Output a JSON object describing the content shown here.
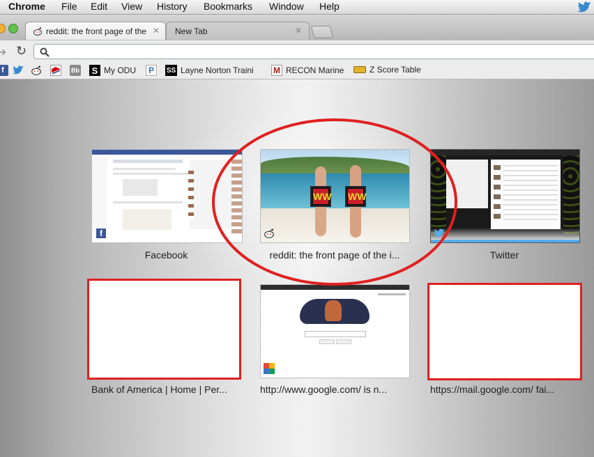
{
  "menubar": {
    "app": "Chrome",
    "items": [
      "File",
      "Edit",
      "View",
      "History",
      "Bookmarks",
      "Window",
      "Help"
    ]
  },
  "tabs": [
    {
      "label": "reddit: the front page of the"
    },
    {
      "label": "New Tab"
    }
  ],
  "toolbar": {
    "omnibox_value": ""
  },
  "bookmarks": [
    {
      "label": "My ODU",
      "icon": "s-icon"
    },
    {
      "label": "P",
      "icon": "p-icon"
    },
    {
      "label": "Layne Norton Traini",
      "icon": "ss-icon"
    },
    {
      "label": "RECON Marine",
      "icon": "m-icon"
    },
    {
      "label": "Z Score Table",
      "icon": "z-score-icon"
    }
  ],
  "tiles": [
    {
      "title": "Facebook"
    },
    {
      "title": "reddit: the front page of the i..."
    },
    {
      "title": "Twitter"
    },
    {
      "title": "Bank of America | Home | Per..."
    },
    {
      "title": "http://www.google.com/ is n..."
    },
    {
      "title": "https://mail.google.com/ fai..."
    }
  ],
  "overlay": {
    "watermark": "WW"
  },
  "colors": {
    "highlight_ring": "#e02020",
    "facebook_blue": "#3b5998",
    "twitter_blue": "#55acee"
  }
}
